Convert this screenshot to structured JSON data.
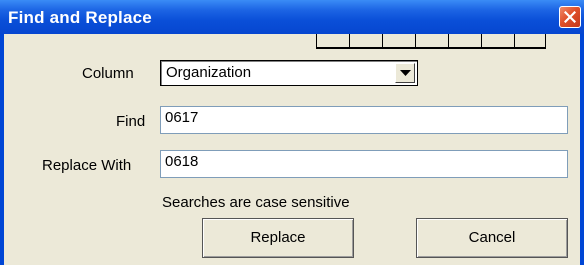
{
  "window": {
    "title": "Find and Replace"
  },
  "form": {
    "column_label": "Column",
    "column_value": "Organization",
    "find_label": "Find",
    "find_value": "0617",
    "replace_label": "Replace With",
    "replace_value": "0618",
    "note": "Searches are case sensitive"
  },
  "buttons": {
    "replace_label": "Replace",
    "cancel_label": "Cancel"
  },
  "icons": {
    "close": "close-icon",
    "dropdown": "chevron-down-icon"
  },
  "colors": {
    "title_bar": "#0a4fd8",
    "dialog_bg": "#ece9d8",
    "close_button": "#e0502a"
  }
}
